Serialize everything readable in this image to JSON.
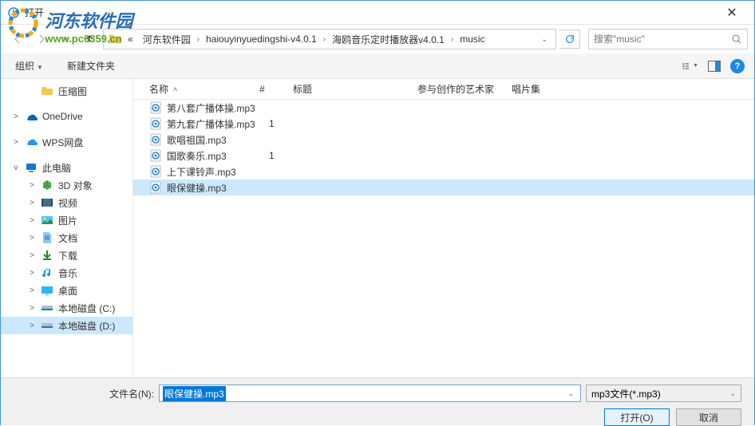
{
  "watermark": {
    "title": "河东软件园",
    "url": "www.pc0359.cn"
  },
  "titlebar": {
    "title": "打开"
  },
  "nav": {
    "crumbs": [
      "河东软件园",
      "haiouyinyuedingshi-v4.0.1",
      "海鸥音乐定时播放器v4.0.1",
      "music"
    ],
    "prefix": "«",
    "search_placeholder": "搜索\"music\""
  },
  "toolbar": {
    "organize": "组织",
    "newfolder": "新建文件夹"
  },
  "sidebar": {
    "items": [
      {
        "label": "压缩图",
        "icon": "folder",
        "indent": true
      },
      {
        "label": "OneDrive",
        "icon": "onedrive",
        "expand": ">"
      },
      {
        "label": "WPS网盘",
        "icon": "wps",
        "expand": ">"
      },
      {
        "label": "此电脑",
        "icon": "pc",
        "expand": "v"
      },
      {
        "label": "3D 对象",
        "icon": "3d",
        "indent": true,
        "expand": ">"
      },
      {
        "label": "视频",
        "icon": "video",
        "indent": true,
        "expand": ">"
      },
      {
        "label": "图片",
        "icon": "pictures",
        "indent": true,
        "expand": ">"
      },
      {
        "label": "文档",
        "icon": "docs",
        "indent": true,
        "expand": ">"
      },
      {
        "label": "下载",
        "icon": "downloads",
        "indent": true,
        "expand": ">"
      },
      {
        "label": "音乐",
        "icon": "music",
        "indent": true,
        "expand": ">"
      },
      {
        "label": "桌面",
        "icon": "desktop",
        "indent": true,
        "expand": ">"
      },
      {
        "label": "本地磁盘 (C:)",
        "icon": "disk",
        "indent": true,
        "expand": ">"
      },
      {
        "label": "本地磁盘 (D:)",
        "icon": "disk",
        "indent": true,
        "expand": ">",
        "selected": true
      }
    ]
  },
  "columns": {
    "name": "名称",
    "num": "#",
    "title": "标题",
    "artist": "参与创作的艺术家",
    "album": "唱片集"
  },
  "files": [
    {
      "name": "第八套广播体操.mp3",
      "num": ""
    },
    {
      "name": "第九套广播体操.mp3",
      "num": "1"
    },
    {
      "name": "歌唱祖国.mp3",
      "num": ""
    },
    {
      "name": "国歌奏乐.mp3",
      "num": "1"
    },
    {
      "name": "上下课铃声.mp3",
      "num": ""
    },
    {
      "name": "眼保健操.mp3",
      "num": "",
      "selected": true
    }
  ],
  "bottom": {
    "filename_label": "文件名(N):",
    "filename_value": "眼保健操.mp3",
    "filter": "mp3文件(*.mp3)",
    "open": "打开(O)",
    "cancel": "取消"
  }
}
